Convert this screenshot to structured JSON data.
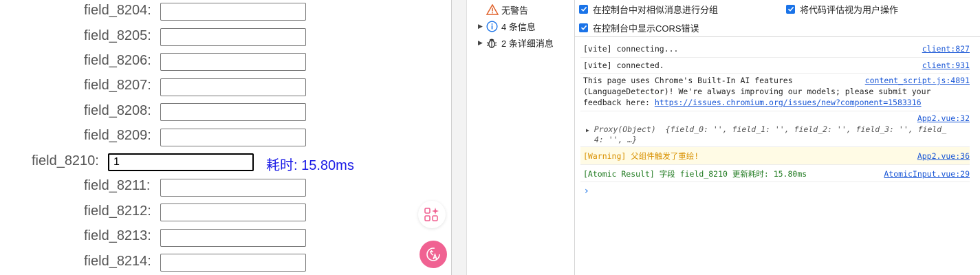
{
  "form": {
    "rows": [
      {
        "label": "field_8204:",
        "value": ""
      },
      {
        "label": "field_8205:",
        "value": ""
      },
      {
        "label": "field_8206:",
        "value": ""
      },
      {
        "label": "field_8207:",
        "value": ""
      },
      {
        "label": "field_8208:",
        "value": ""
      },
      {
        "label": "field_8209:",
        "value": ""
      },
      {
        "label": "field_8210:",
        "value": "1"
      },
      {
        "label": "field_8211:",
        "value": ""
      },
      {
        "label": "field_8212:",
        "value": ""
      },
      {
        "label": "field_8213:",
        "value": ""
      },
      {
        "label": "field_8214:",
        "value": ""
      }
    ],
    "timing_text": "耗时: 15.80ms"
  },
  "devtools": {
    "sidebar": {
      "items": [
        {
          "label": "无警告",
          "icon": "warning-icon"
        },
        {
          "label": "4 条信息",
          "icon": "info-icon"
        },
        {
          "label": "2 条详细消息",
          "icon": "bug-icon"
        }
      ]
    },
    "settings": {
      "group_similar": "在控制台中对相似消息进行分组",
      "treat_eval": "将代码评估视为用户操作",
      "show_cors": "在控制台中显示CORS错误"
    },
    "messages": [
      {
        "text": "[vite] connecting...",
        "source": "client:827"
      },
      {
        "text": "[vite] connected.",
        "source": "client:931"
      },
      {
        "line1": "This page uses Chrome's Built-In AI features",
        "line2": "(LanguageDetector)! We're always improving our models; please submit your",
        "line3_prefix": "feedback here: ",
        "url": "https://issues.chromium.org/issues/new?component=1583316",
        "source": "content_script.js:4891"
      },
      {
        "source": "App2.vue:32",
        "proxy_label": "Proxy(Object)",
        "preview_line1": "{field_0: '', field_1: '', field_2: '', field_3: '', field_",
        "preview_line2": "4: '', …}"
      },
      {
        "text": "[Warning] 父组件触发了重绘!",
        "source": "App2.vue:36"
      },
      {
        "text": "[Atomic Result] 字段 field_8210 更新耗时: 15.80ms",
        "source": "AtomicInput.vue:29"
      }
    ],
    "prompt_glyph": "›"
  },
  "colors": {
    "accent": "#1a73e8",
    "timing": "#1a1ae6",
    "warning": "#d89000",
    "success": "#1f7a1f",
    "link": "#1a57d6",
    "float_pink": "#f06292"
  }
}
